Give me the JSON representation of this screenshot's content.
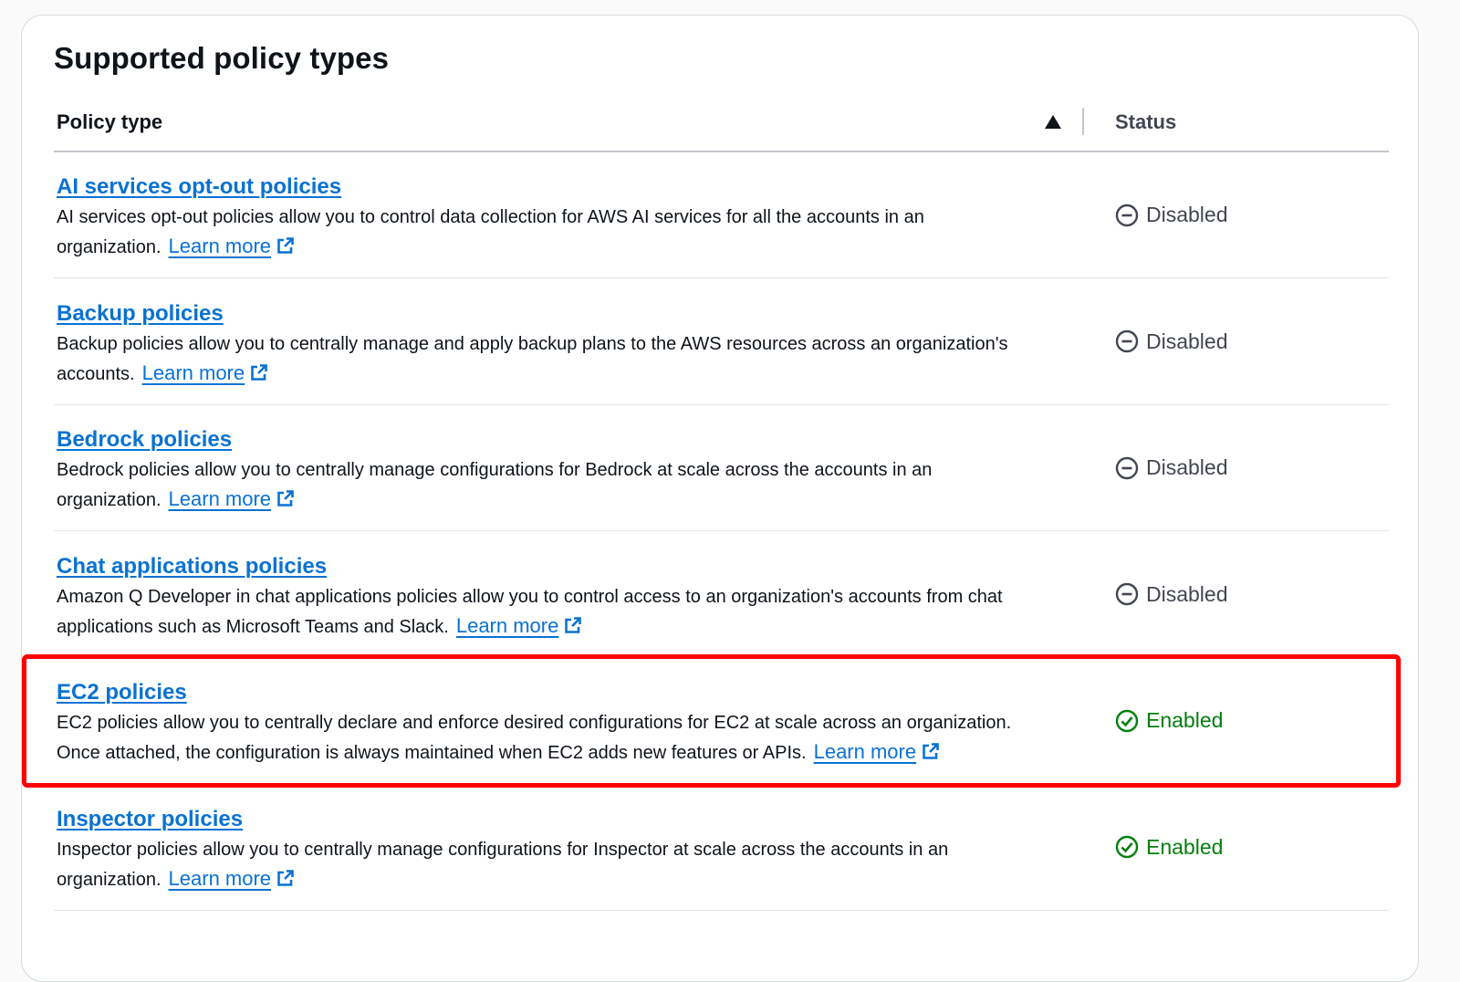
{
  "panel": {
    "title": "Supported policy types"
  },
  "table": {
    "columns": {
      "policy_type": "Policy type",
      "status": "Status"
    },
    "sort": {
      "column": "Policy type",
      "direction": "ascending",
      "icon": "caret-up-filled-icon"
    },
    "rows": [
      {
        "title": "AI services opt-out policies",
        "description": "AI services opt-out policies allow you to control data collection for AWS AI services for all the accounts in an organization.",
        "link": "Learn more",
        "status": "Disabled",
        "status_icon": "status-stopped-icon"
      },
      {
        "title": "Backup policies",
        "description": "Backup policies allow you to centrally manage and apply backup plans to the AWS resources across an organization's accounts.",
        "link": "Learn more",
        "status": "Disabled",
        "status_icon": "status-stopped-icon"
      },
      {
        "title": "Bedrock policies",
        "description": "Bedrock policies allow you to centrally manage configurations for Bedrock at scale across the accounts in an organization.",
        "link": "Learn more",
        "status": "Disabled",
        "status_icon": "status-stopped-icon"
      },
      {
        "title": "Chat applications policies",
        "description": "Amazon Q Developer in chat applications policies allow you to control access to an organization's accounts from chat applications such as Microsoft Teams and Slack.",
        "link": "Learn more",
        "status": "Disabled",
        "status_icon": "status-stopped-icon"
      },
      {
        "title": "EC2 policies",
        "description": "EC2 policies allow you to centrally declare and enforce desired configurations for EC2 at scale across an organization. Once attached, the configuration is always maintained when EC2 adds new features or APIs.",
        "link": "Learn more",
        "status": "Enabled",
        "status_icon": "status-positive-icon",
        "highlighted": true
      },
      {
        "title": "Inspector policies",
        "description": "Inspector policies allow you to centrally manage configurations for Inspector at scale across the accounts in an organization.",
        "link": "Learn more",
        "status": "Enabled",
        "status_icon": "status-positive-icon"
      }
    ]
  },
  "colors": {
    "link": "#0972d3",
    "text": "#0f141a",
    "disabled": "#424650",
    "enabled": "#037f0c",
    "highlight": "#ff0000"
  }
}
